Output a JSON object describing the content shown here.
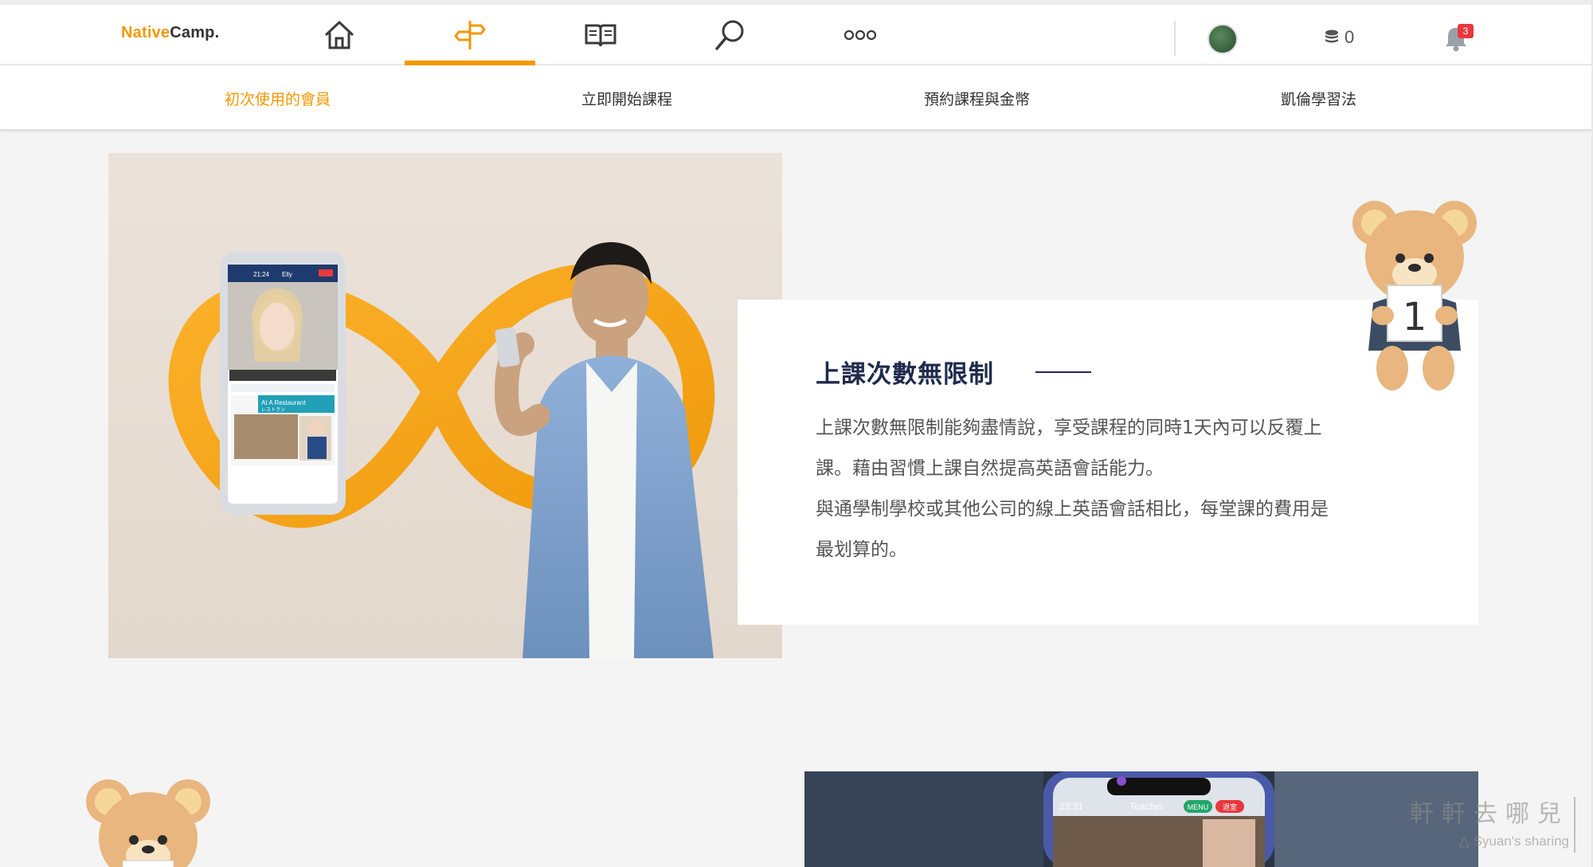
{
  "header": {
    "logo_part1": "Native",
    "logo_part2": "Camp.",
    "nav_icons": [
      "home-icon",
      "signpost-icon",
      "book-icon",
      "search-icon",
      "more-icon"
    ],
    "active_nav": "signpost-icon",
    "coin_count": "0",
    "notification_count": "3",
    "accent_color": "#f39800"
  },
  "subnav": {
    "items": [
      {
        "label": "初次使用的會員",
        "active": true
      },
      {
        "label": "立即開始課程",
        "active": false
      },
      {
        "label": "預約課程與金幣",
        "active": false
      },
      {
        "label": "凱倫學習法",
        "active": false
      }
    ]
  },
  "hero": {
    "phone_screen_name": "Elly",
    "phone_lesson_title": "At A Restaurant",
    "phone_lesson_sub": "レストラン",
    "phone_time": "21:24"
  },
  "card": {
    "title": "上課次數無限制",
    "body_lines": [
      "上課次數無限制能夠盡情說，享受課程的同時1天內可以反覆上",
      "課。藉由習慣上課自然提高英語會話能力。",
      "與通學制學校或其他公司的線上英語會話相比，每堂課的費用是",
      "最划算的。"
    ],
    "bear_sign_number": "1"
  },
  "bottom_section": {
    "phone_time": "23:31",
    "phone_label": "Teacher",
    "menu_label": "MENU",
    "exit_label": "退室"
  },
  "watermark": {
    "chinese": "軒軒去哪兒",
    "english": "Syuan's sharing"
  }
}
